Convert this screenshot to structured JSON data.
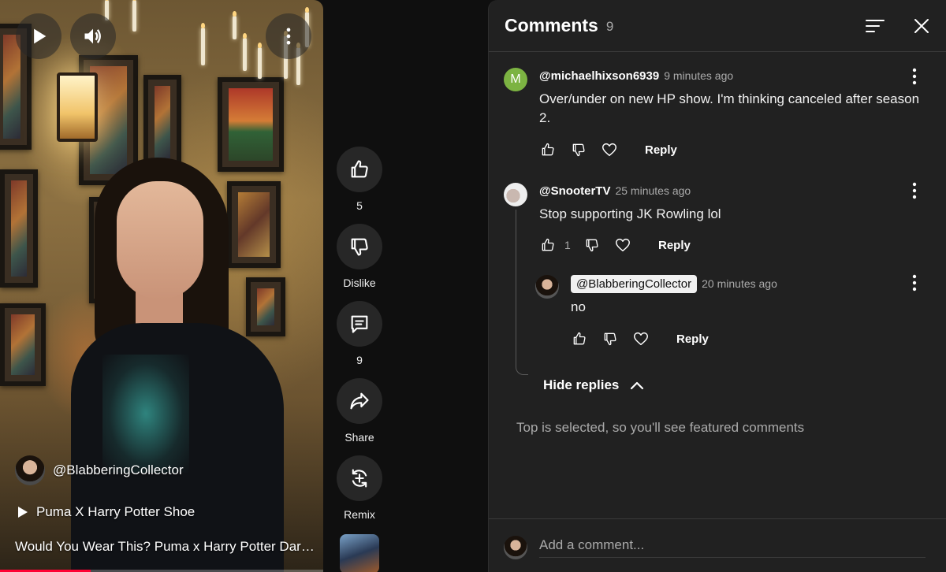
{
  "video": {
    "channel": "@BlabberingCollector",
    "music": "Puma X Harry Potter Shoe",
    "title": "Would You Wear This? Puma x Harry Potter Dark Arts Shoes Review",
    "progress_fraction": 0.28
  },
  "actions": {
    "like_count": "5",
    "dislike_label": "Dislike",
    "comment_count": "9",
    "share_label": "Share",
    "remix_label": "Remix"
  },
  "comments_panel": {
    "title": "Comments",
    "count": "9",
    "comments": [
      {
        "avatar_letter": "M",
        "author": "@michaelhixson6939",
        "time": "9 minutes ago",
        "text": "Over/under on new HP show. I'm thinking canceled after season 2.",
        "reply_label": "Reply"
      },
      {
        "author": "@SnooterTV",
        "time": "25 minutes ago",
        "text": "Stop supporting JK Rowling lol",
        "likes": "1",
        "reply_label": "Reply"
      },
      {
        "author": "@BlabberingCollector",
        "time": "20 minutes ago",
        "text": "no",
        "reply_label": "Reply"
      }
    ],
    "hide_replies_label": "Hide replies",
    "notice": "Top is selected, so you'll see featured comments",
    "add_comment_placeholder": "Add a comment..."
  },
  "colors": {
    "accent_red": "#ff0033",
    "panel_bg": "#212121",
    "avatar_green": "#7cb342"
  }
}
